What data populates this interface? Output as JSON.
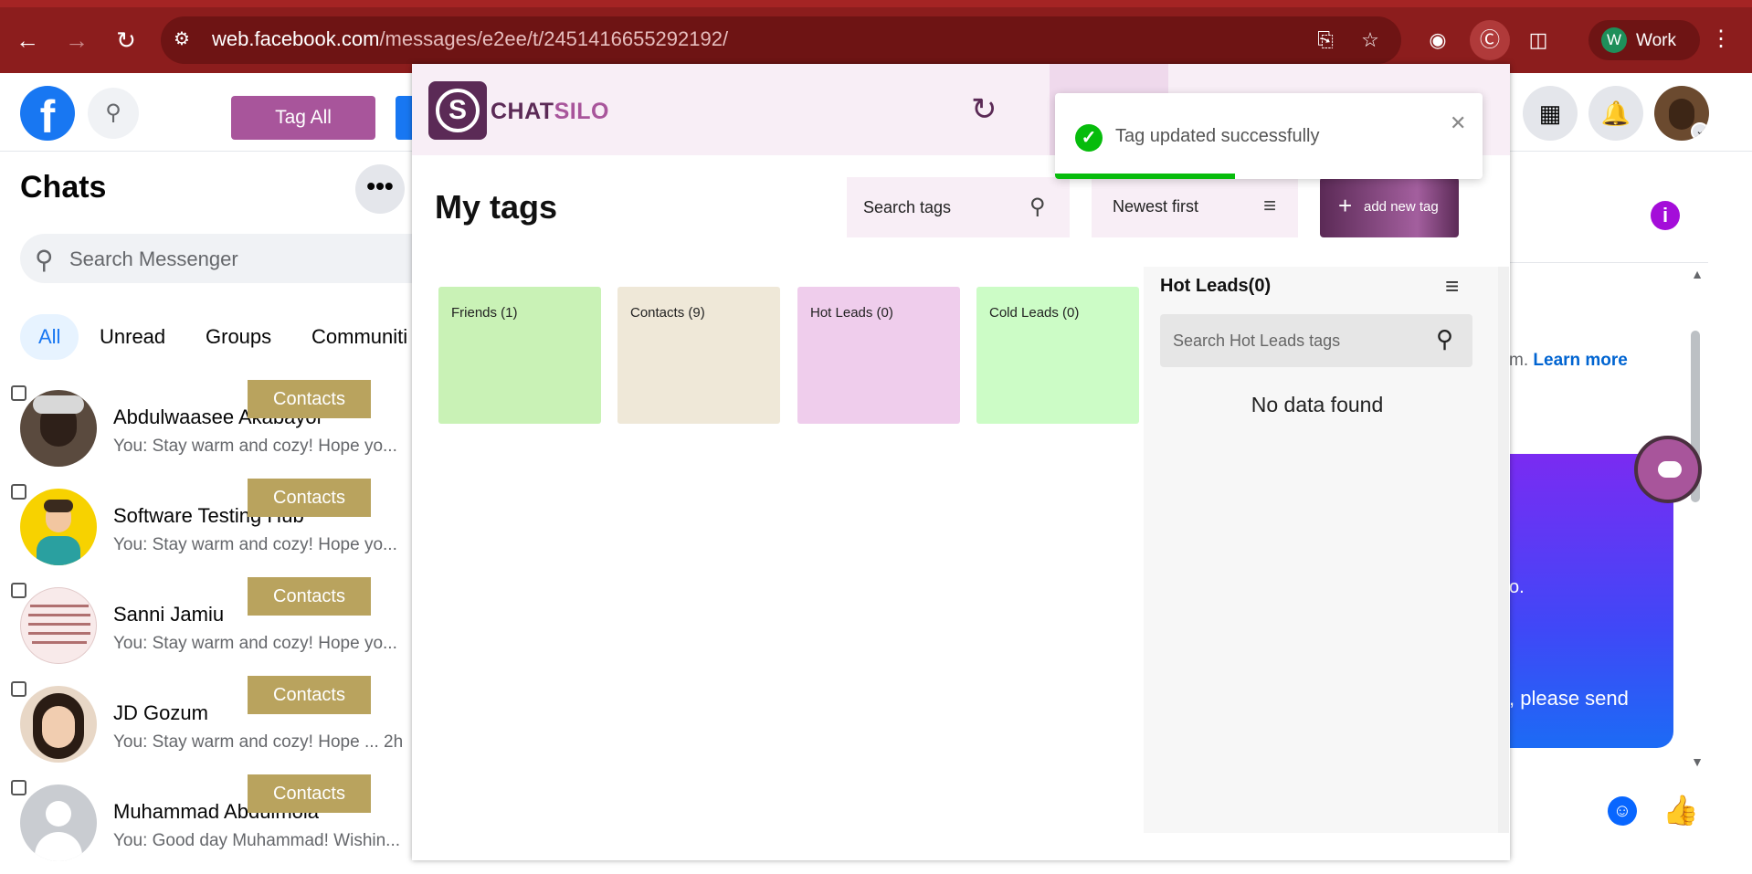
{
  "browser": {
    "url_host": "web.facebook.com",
    "url_path": "/messages/e2ee/t/2451416655292192/",
    "profile_initial": "W",
    "profile_label": "Work",
    "icons": [
      "back-arrow-icon",
      "forward-arrow-icon",
      "reload-icon",
      "site-info-icon",
      "install-icon",
      "star-icon",
      "color-ext-icon",
      "chatsilo-ext-icon",
      "puzzle-icon",
      "kebab-menu-icon"
    ]
  },
  "fb": {
    "logo": "f",
    "tag_all_label": "Tag All",
    "chats_title": "Chats",
    "more_label": "•••",
    "search_placeholder": "Search Messenger",
    "tabs": [
      {
        "label": "All",
        "active": true
      },
      {
        "label": "Unread",
        "active": false
      },
      {
        "label": "Groups",
        "active": false
      },
      {
        "label": "Communiti",
        "active": false
      }
    ],
    "chats": [
      {
        "name": "Abdulwaasee Akabayor",
        "preview": "You: Stay warm and cozy! Hope yo...",
        "tag": "Contacts"
      },
      {
        "name": "Software Testing Hub",
        "preview": "You: Stay warm and cozy! Hope yo...",
        "tag": "Contacts"
      },
      {
        "name": "Sanni Jamiu",
        "preview": "You: Stay warm and cozy! Hope yo...",
        "tag": "Contacts"
      },
      {
        "name": "JD Gozum",
        "preview": "You: Stay warm and cozy! Hope ...  2h",
        "tag": "Contacts"
      },
      {
        "name": "Muhammad Abdulmola",
        "preview": "You: Good day Muhammad! Wishin...",
        "tag": "Contacts"
      }
    ],
    "learn_prefix": "m.",
    "learn_more": "Learn more",
    "message_fragment_1": "o.",
    "message_fragment_2": ", please send",
    "info_label": "i"
  },
  "chatsilo": {
    "brand_part1": "CHAT",
    "brand_part2": "SILO",
    "title": "My tags",
    "search_placeholder": "Search tags",
    "sort_label": "Newest first",
    "add_label": "add new tag",
    "tags": [
      {
        "label": "Friends (1)",
        "color": "#c9f2b6"
      },
      {
        "label": "Contacts (9)",
        "color": "#efe8d8"
      },
      {
        "label": "Hot Leads (0)",
        "color": "#efcdec"
      },
      {
        "label": "Cold Leads (0)",
        "color": "#ccfcc6"
      }
    ],
    "detail": {
      "heading": "Hot Leads(0)",
      "search_placeholder": "Search Hot Leads tags",
      "empty": "No data found"
    },
    "toast": {
      "message": "Tag updated successfully",
      "progress": 0.42
    }
  }
}
